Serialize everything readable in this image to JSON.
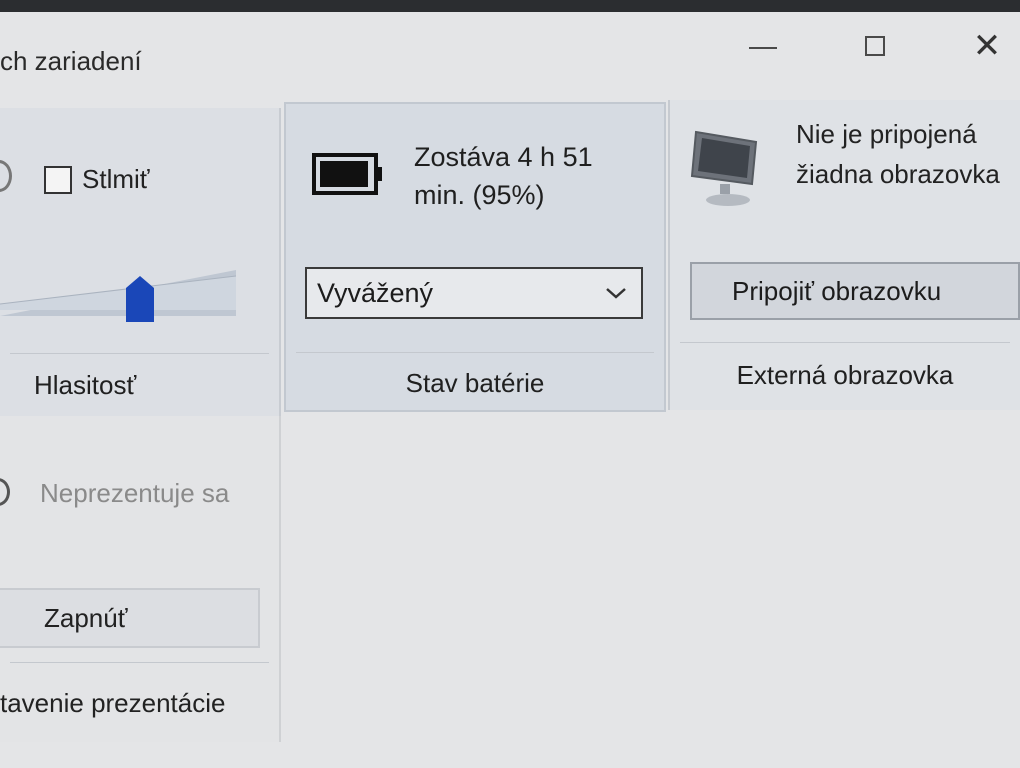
{
  "window": {
    "title": "ch zariadení",
    "controls": {
      "minimize_icon": "minimize-icon",
      "maximize_icon": "maximize-icon",
      "close_icon": "close-icon",
      "close_glyph": "✕"
    }
  },
  "volume": {
    "mute_label": "Stlmiť",
    "muted": false,
    "footer": "Hlasitosť",
    "icon": "speaker-icon"
  },
  "battery": {
    "status_text": "Zostáva 4 h 51 min. (95%)",
    "charge_percent": 95,
    "power_plan": "Vyvážený",
    "footer": "Stav batérie",
    "icon": "battery-icon"
  },
  "external_display": {
    "status_text": "Nie je pripojená žiadna obrazovka",
    "connect_button": "Pripojiť obrazovku",
    "footer": "Externá obrazovka",
    "icon": "monitor-icon"
  },
  "presentation": {
    "status_text": "Neprezentuje sa",
    "toggle_button": "Zapnúť",
    "footer": "tavenie prezentácie",
    "icon": "projector-icon"
  },
  "colors": {
    "slider_accent": "#1a47b8",
    "battery_fill": "#111111"
  }
}
